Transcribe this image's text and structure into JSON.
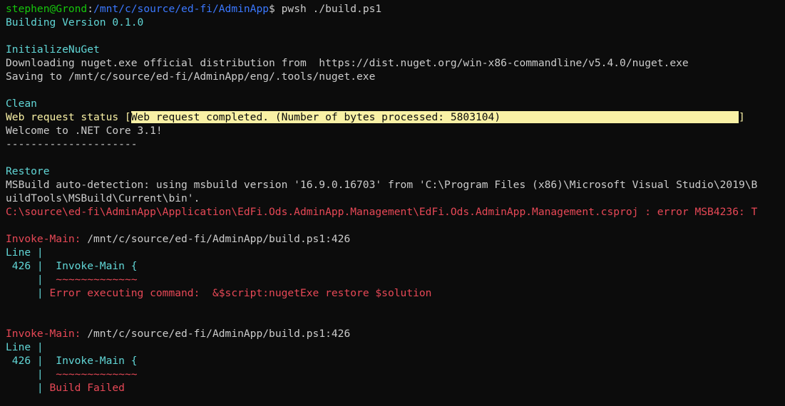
{
  "colors": {
    "background": "#0c0c0c",
    "default": "#cccccc",
    "green": "#16c60c",
    "blue": "#3b78ff",
    "cyan": "#61d6d6",
    "red": "#e74856",
    "yellow": "#f9f1a5",
    "highlight_bg": "#f9f1a5",
    "highlight_fg": "#0c0c0c"
  },
  "lines": [
    [
      {
        "t": "stephen@Grond",
        "c": "green"
      },
      {
        "t": ":",
        "c": "default"
      },
      {
        "t": "/mnt/c/source/ed-fi/AdminApp",
        "c": "blue"
      },
      {
        "t": "$ pwsh ./build.ps1",
        "c": "default"
      }
    ],
    [
      {
        "t": "Building Version 0.1.0",
        "c": "cyan"
      }
    ],
    [],
    [
      {
        "t": "InitializeNuGet",
        "c": "cyan"
      }
    ],
    [
      {
        "t": "Downloading nuget.exe official distribution from  https://dist.nuget.org/win-x86-commandline/v5.4.0/nuget.exe",
        "c": "default"
      }
    ],
    [
      {
        "t": "Saving to /mnt/c/source/ed-fi/AdminApp/eng/.tools/nuget.exe",
        "c": "default"
      }
    ],
    [],
    [
      {
        "t": "Clean",
        "c": "cyan"
      }
    ],
    [
      {
        "t": "Web request status [",
        "c": "yellow"
      },
      {
        "t": "Web request completed. (Number of bytes processed: 5803104)                                      ",
        "c": "highlight"
      },
      {
        "t": "]",
        "c": "yellow"
      }
    ],
    [
      {
        "t": "Welcome to .NET Core 3.1!",
        "c": "default"
      }
    ],
    [
      {
        "t": "---------------------",
        "c": "default"
      }
    ],
    [],
    [
      {
        "t": "Restore",
        "c": "cyan"
      }
    ],
    [
      {
        "t": "MSBuild auto-detection: using msbuild version '16.9.0.16703' from 'C:\\Program Files (x86)\\Microsoft Visual Studio\\2019\\B",
        "c": "default"
      }
    ],
    [
      {
        "t": "uildTools\\MSBuild\\Current\\bin'.",
        "c": "default"
      }
    ],
    [
      {
        "t": "C:\\source\\ed-fi\\AdminApp\\Application\\EdFi.Ods.AdminApp.Management\\EdFi.Ods.AdminApp.Management.csproj : error MSB4236: T",
        "c": "red"
      }
    ],
    [],
    [
      {
        "t": "Invoke-Main: ",
        "c": "red"
      },
      {
        "t": "/mnt/c/source/ed-fi/AdminApp/build.ps1:426",
        "c": "default"
      }
    ],
    [
      {
        "t": "Line |",
        "c": "cyan"
      }
    ],
    [
      {
        "t": " 426 |  Invoke-Main {",
        "c": "cyan"
      }
    ],
    [
      {
        "t": "     |  ",
        "c": "cyan"
      },
      {
        "t": "~~~~~~~~~~~~~",
        "c": "red"
      }
    ],
    [
      {
        "t": "     | ",
        "c": "cyan"
      },
      {
        "t": "Error executing command:  &$script:nugetExe restore $solution",
        "c": "red"
      }
    ],
    [],
    [],
    [
      {
        "t": "Invoke-Main: ",
        "c": "red"
      },
      {
        "t": "/mnt/c/source/ed-fi/AdminApp/build.ps1:426",
        "c": "default"
      }
    ],
    [
      {
        "t": "Line |",
        "c": "cyan"
      }
    ],
    [
      {
        "t": " 426 |  Invoke-Main {",
        "c": "cyan"
      }
    ],
    [
      {
        "t": "     |  ",
        "c": "cyan"
      },
      {
        "t": "~~~~~~~~~~~~~",
        "c": "red"
      }
    ],
    [
      {
        "t": "     | ",
        "c": "cyan"
      },
      {
        "t": "Build Failed",
        "c": "red"
      }
    ]
  ]
}
